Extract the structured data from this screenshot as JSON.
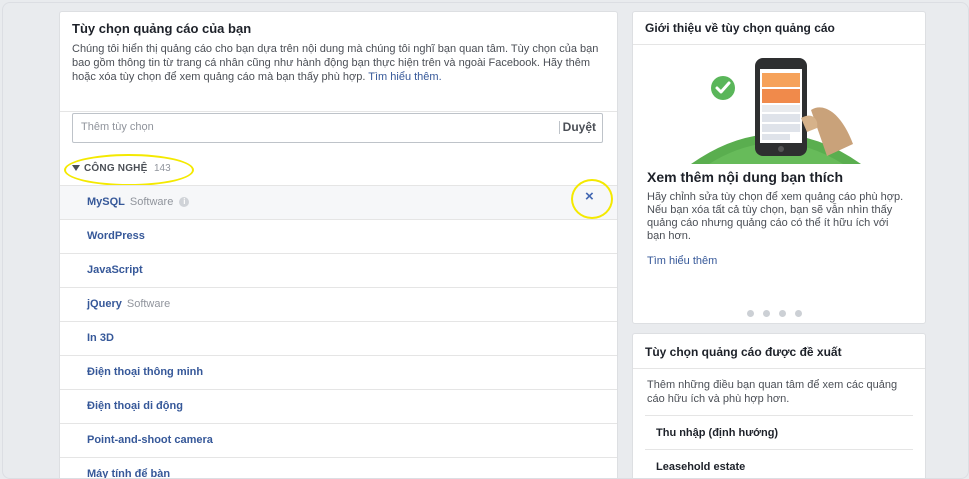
{
  "preferences": {
    "title": "Tùy chọn quảng cáo của bạn",
    "description": "Chúng tôi hiển thị quảng cáo cho bạn dựa trên nội dung mà chúng tôi nghĩ bạn quan tâm. Tùy chọn của bạn bao gồm thông tin từ trang cá nhân cũng như hành động bạn thực hiện trên và ngoài Facebook. Hãy thêm hoặc xóa tùy chọn để xem quảng cáo mà bạn thấy phù hợp.",
    "learn_more": "Tìm hiểu thêm.",
    "search_placeholder": "Thêm tùy chọn",
    "browse_label": "Duyệt",
    "category": {
      "label": "CÔNG NGHỆ",
      "count": "143"
    },
    "items": [
      {
        "name": "MySQL",
        "type": "Software"
      },
      {
        "name": "WordPress",
        "type": ""
      },
      {
        "name": "JavaScript",
        "type": ""
      },
      {
        "name": "jQuery",
        "type": "Software"
      },
      {
        "name": "In 3D",
        "type": ""
      },
      {
        "name": "Điện thoại thông minh",
        "type": ""
      },
      {
        "name": "Điện thoại di động",
        "type": ""
      },
      {
        "name": "Point-and-shoot camera",
        "type": ""
      },
      {
        "name": "Máy tính để bàn",
        "type": ""
      }
    ],
    "remove_icon": "×",
    "info_icon": "i"
  },
  "about": {
    "title": "Giới thiệu về tùy chọn quảng cáo",
    "subtitle": "Xem thêm nội dung bạn thích",
    "description": "Hãy chỉnh sửa tùy chọn để xem quảng cáo phù hợp. Nếu bạn xóa tất cả tùy chọn, bạn sẽ vẫn nhìn thấy quảng cáo nhưng quảng cáo có thể ít hữu ích với bạn hơn.",
    "learn_more": "Tìm hiểu thêm"
  },
  "suggested": {
    "title": "Tùy chọn quảng cáo được đề xuất",
    "description": "Thêm những điều bạn quan tâm để xem các quảng cáo hữu ích và phù hợp hơn.",
    "items": [
      "Thu nhập (định hướng)",
      "Leasehold estate"
    ]
  },
  "colors": {
    "link": "#365899",
    "highlight": "#f4e900",
    "accent": "#4267b2",
    "check": "#5ab65a",
    "grass": "#5aae4f"
  }
}
